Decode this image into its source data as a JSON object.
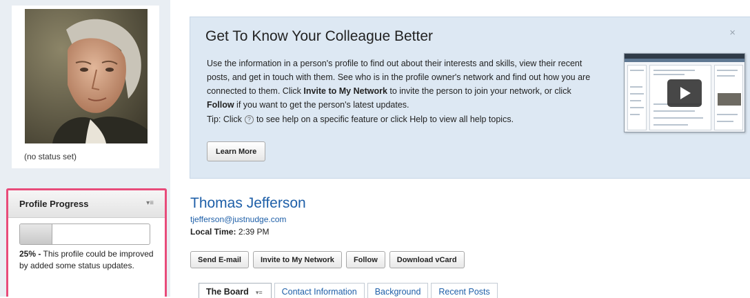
{
  "profile_card": {
    "status": "(no status set)"
  },
  "progress_widget": {
    "title": "Profile Progress",
    "menu_icon": "menu-icon",
    "progress_fraction": 0.25,
    "percent_text": "25% -",
    "message": "This profile could be improved by added some status updates."
  },
  "banner": {
    "title": "Get To Know Your Colleague Better",
    "body_part1": "Use the information in a person's profile to find out about their interests and skills, view their recent posts, and get in touch with them. See who is in the profile owner's network and find out how you are connected to them. Click ",
    "body_bold1": "Invite to My Network",
    "body_part2": " to invite the person to join your network, or click ",
    "body_bold2": "Follow",
    "body_part3": " if you want to get the person's latest updates.",
    "tip_prefix": "Tip: Click",
    "tip_suffix": "to see help on a specific feature or click Help to view all help topics.",
    "learn_more": "Learn More",
    "close_glyph": "×",
    "help_glyph": "?"
  },
  "profile": {
    "name": "Thomas Jefferson",
    "email": "tjefferson@justnudge.com",
    "local_time_label": "Local Time:",
    "local_time_value": "2:39 PM"
  },
  "actions": {
    "send_email": "Send E-mail",
    "invite": "Invite to My Network",
    "follow": "Follow",
    "download_vcard": "Download vCard"
  },
  "tabs": [
    {
      "label": "The Board"
    },
    {
      "label": "Contact Information"
    },
    {
      "label": "Background"
    },
    {
      "label": "Recent Posts"
    }
  ],
  "colors": {
    "accent_link": "#1e5fa8",
    "highlight_border": "#e84b7a",
    "banner_bg": "#dde8f3"
  }
}
